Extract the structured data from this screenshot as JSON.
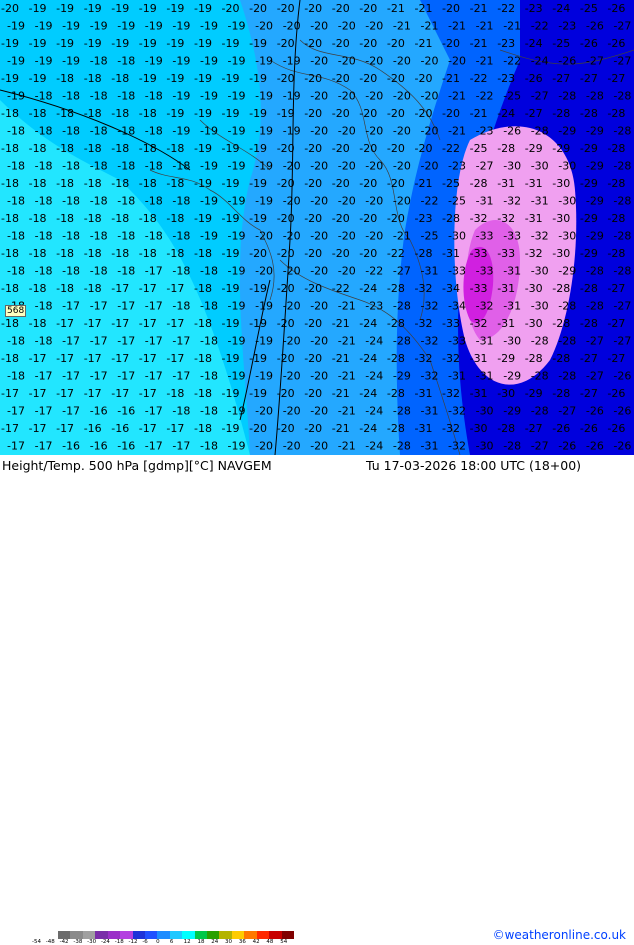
{
  "map": {
    "parameter_label": "Height/Temp. 500 hPa [gdmp][°C] NAVGEM",
    "valid_time": "Tu 17-03-2026 18:00 UTC (18+00)",
    "credit": "©weatheronline.co.uk",
    "station_marker": "568",
    "colors": {
      "temp_m19": "#00ccff",
      "temp_m18": "#22e6ff",
      "temp_m20": "#24a8ff",
      "temp_m24": "#0064ff",
      "temp_m28": "#0000dd",
      "temp_m30": "#f0a0f0",
      "temp_m33": "#e060e8",
      "temp_m34": "#d020e0"
    },
    "temperature_labels": [
      {
        "row": 0,
        "values": [
          "-20",
          "-19",
          "-19",
          "-19",
          "-19",
          "-19",
          "-19",
          "-19",
          "-20",
          "-20",
          "-20",
          "-20",
          "-20",
          "-20",
          "-21",
          "-21",
          "-20",
          "-21",
          "-22",
          "-23",
          "-24",
          "-25",
          "-26"
        ]
      },
      {
        "row": 1,
        "values": [
          "-19",
          "-19",
          "-19",
          "-19",
          "-19",
          "-19",
          "-19",
          "-19",
          "-19",
          "-20",
          "-20",
          "-20",
          "-20",
          "-20",
          "-21",
          "-21",
          "-21",
          "-21",
          "-21",
          "-22",
          "-23",
          "-26",
          "-27"
        ]
      },
      {
        "row": 2,
        "values": [
          "-19",
          "-19",
          "-19",
          "-19",
          "-19",
          "-19",
          "-19",
          "-19",
          "-19",
          "-19",
          "-20",
          "-20",
          "-20",
          "-20",
          "-20",
          "-21",
          "-20",
          "-21",
          "-23",
          "-24",
          "-25",
          "-26",
          "-26"
        ]
      },
      {
        "row": 3,
        "values": [
          "-19",
          "-19",
          "-19",
          "-18",
          "-18",
          "-19",
          "-19",
          "-19",
          "-19",
          "-19",
          "-19",
          "-20",
          "-20",
          "-20",
          "-20",
          "-20",
          "-20",
          "-21",
          "-22",
          "-24",
          "-26",
          "-27",
          "-27"
        ]
      },
      {
        "row": 4,
        "values": [
          "-19",
          "-19",
          "-18",
          "-18",
          "-18",
          "-19",
          "-19",
          "-19",
          "-19",
          "-19",
          "-20",
          "-20",
          "-20",
          "-20",
          "-20",
          "-20",
          "-21",
          "-22",
          "-23",
          "-26",
          "-27",
          "-27",
          "-27"
        ]
      },
      {
        "row": 5,
        "values": [
          "-19",
          "-18",
          "-18",
          "-18",
          "-18",
          "-18",
          "-19",
          "-19",
          "-19",
          "-19",
          "-19",
          "-20",
          "-20",
          "-20",
          "-20",
          "-20",
          "-21",
          "-22",
          "-25",
          "-27",
          "-28",
          "-28",
          "-28"
        ]
      },
      {
        "row": 6,
        "values": [
          "-18",
          "-18",
          "-18",
          "-18",
          "-18",
          "-18",
          "-19",
          "-19",
          "-19",
          "-19",
          "-19",
          "-20",
          "-20",
          "-20",
          "-20",
          "-20",
          "-20",
          "-21",
          "-24",
          "-27",
          "-28",
          "-28",
          "-28"
        ]
      },
      {
        "row": 7,
        "values": [
          "-18",
          "-18",
          "-18",
          "-18",
          "-18",
          "-18",
          "-19",
          "-19",
          "-19",
          "-19",
          "-19",
          "-20",
          "-20",
          "-20",
          "-20",
          "-20",
          "-21",
          "-23",
          "-26",
          "-28",
          "-29",
          "-29",
          "-28"
        ]
      },
      {
        "row": 8,
        "values": [
          "-18",
          "-18",
          "-18",
          "-18",
          "-18",
          "-18",
          "-18",
          "-19",
          "-19",
          "-19",
          "-20",
          "-20",
          "-20",
          "-20",
          "-20",
          "-20",
          "-22",
          "-25",
          "-28",
          "-29",
          "-29",
          "-29",
          "-28"
        ]
      },
      {
        "row": 9,
        "values": [
          "-18",
          "-18",
          "-18",
          "-18",
          "-18",
          "-18",
          "-18",
          "-19",
          "-19",
          "-19",
          "-20",
          "-20",
          "-20",
          "-20",
          "-20",
          "-20",
          "-23",
          "-27",
          "-30",
          "-30",
          "-30",
          "-29",
          "-28"
        ]
      },
      {
        "row": 10,
        "values": [
          "-18",
          "-18",
          "-18",
          "-18",
          "-18",
          "-18",
          "-18",
          "-19",
          "-19",
          "-19",
          "-20",
          "-20",
          "-20",
          "-20",
          "-20",
          "-21",
          "-25",
          "-28",
          "-31",
          "-31",
          "-30",
          "-29",
          "-28"
        ]
      },
      {
        "row": 11,
        "values": [
          "-18",
          "-18",
          "-18",
          "-18",
          "-18",
          "-18",
          "-18",
          "-19",
          "-19",
          "-19",
          "-20",
          "-20",
          "-20",
          "-20",
          "-20",
          "-22",
          "-25",
          "-31",
          "-32",
          "-31",
          "-30",
          "-29",
          "-28"
        ]
      },
      {
        "row": 12,
        "values": [
          "-18",
          "-18",
          "-18",
          "-18",
          "-18",
          "-18",
          "-18",
          "-19",
          "-19",
          "-19",
          "-20",
          "-20",
          "-20",
          "-20",
          "-20",
          "-23",
          "-28",
          "-32",
          "-32",
          "-31",
          "-30",
          "-29",
          "-28"
        ]
      },
      {
        "row": 13,
        "values": [
          "-18",
          "-18",
          "-18",
          "-18",
          "-18",
          "-18",
          "-18",
          "-19",
          "-19",
          "-20",
          "-20",
          "-20",
          "-20",
          "-20",
          "-21",
          "-25",
          "-30",
          "-33",
          "-33",
          "-32",
          "-30",
          "-29",
          "-28"
        ]
      },
      {
        "row": 14,
        "values": [
          "-18",
          "-18",
          "-18",
          "-18",
          "-18",
          "-18",
          "-18",
          "-18",
          "-19",
          "-20",
          "-20",
          "-20",
          "-20",
          "-20",
          "-22",
          "-28",
          "-31",
          "-33",
          "-33",
          "-32",
          "-30",
          "-29",
          "-28"
        ]
      },
      {
        "row": 15,
        "values": [
          "-18",
          "-18",
          "-18",
          "-18",
          "-18",
          "-17",
          "-18",
          "-18",
          "-19",
          "-20",
          "-20",
          "-20",
          "-20",
          "-22",
          "-27",
          "-31",
          "-33",
          "-33",
          "-31",
          "-30",
          "-29",
          "-28",
          "-28"
        ]
      },
      {
        "row": 16,
        "values": [
          "-18",
          "-18",
          "-18",
          "-18",
          "-17",
          "-17",
          "-17",
          "-18",
          "-19",
          "-19",
          "-20",
          "-20",
          "-22",
          "-24",
          "-28",
          "-32",
          "-34",
          "-33",
          "-31",
          "-30",
          "-28",
          "-28",
          "-27"
        ]
      },
      {
        "row": 17,
        "values": [
          "-18",
          "-18",
          "-17",
          "-17",
          "-17",
          "-17",
          "-18",
          "-18",
          "-19",
          "-19",
          "-20",
          "-20",
          "-21",
          "-23",
          "-28",
          "-32",
          "-34",
          "-32",
          "-31",
          "-30",
          "-28",
          "-28",
          "-27"
        ]
      },
      {
        "row": 18,
        "values": [
          "-18",
          "-18",
          "-17",
          "-17",
          "-17",
          "-17",
          "-17",
          "-18",
          "-19",
          "-19",
          "-20",
          "-20",
          "-21",
          "-24",
          "-28",
          "-32",
          "-33",
          "-32",
          "-31",
          "-30",
          "-28",
          "-28",
          "-27"
        ]
      },
      {
        "row": 19,
        "values": [
          "-18",
          "-18",
          "-17",
          "-17",
          "-17",
          "-17",
          "-17",
          "-18",
          "-19",
          "-19",
          "-20",
          "-20",
          "-21",
          "-24",
          "-28",
          "-32",
          "-33",
          "-31",
          "-30",
          "-28",
          "-28",
          "-27",
          "-27"
        ]
      },
      {
        "row": 20,
        "values": [
          "-18",
          "-17",
          "-17",
          "-17",
          "-17",
          "-17",
          "-17",
          "-18",
          "-19",
          "-19",
          "-20",
          "-20",
          "-21",
          "-24",
          "-28",
          "-32",
          "-32",
          "-31",
          "-29",
          "-28",
          "-28",
          "-27",
          "-27"
        ]
      },
      {
        "row": 21,
        "values": [
          "-18",
          "-17",
          "-17",
          "-17",
          "-17",
          "-17",
          "-17",
          "-18",
          "-19",
          "-19",
          "-20",
          "-20",
          "-21",
          "-24",
          "-29",
          "-32",
          "-31",
          "-31",
          "-29",
          "-28",
          "-28",
          "-27",
          "-26"
        ]
      },
      {
        "row": 22,
        "values": [
          "-17",
          "-17",
          "-17",
          "-17",
          "-17",
          "-17",
          "-18",
          "-18",
          "-19",
          "-19",
          "-20",
          "-20",
          "-21",
          "-24",
          "-28",
          "-31",
          "-32",
          "-31",
          "-30",
          "-29",
          "-28",
          "-27",
          "-26"
        ]
      },
      {
        "row": 23,
        "values": [
          "-17",
          "-17",
          "-17",
          "-16",
          "-16",
          "-17",
          "-18",
          "-18",
          "-19",
          "-20",
          "-20",
          "-20",
          "-21",
          "-24",
          "-28",
          "-31",
          "-32",
          "-30",
          "-29",
          "-28",
          "-27",
          "-26",
          "-26"
        ]
      },
      {
        "row": 24,
        "values": [
          "-17",
          "-17",
          "-17",
          "-16",
          "-16",
          "-17",
          "-17",
          "-18",
          "-19",
          "-20",
          "-20",
          "-20",
          "-21",
          "-24",
          "-28",
          "-31",
          "-32",
          "-30",
          "-28",
          "-27",
          "-26",
          "-26",
          "-26"
        ]
      },
      {
        "row": 25,
        "values": [
          "-17",
          "-17",
          "-16",
          "-16",
          "-16",
          "-17",
          "-17",
          "-18",
          "-19",
          "-20",
          "-20",
          "-20",
          "-21",
          "-24",
          "-28",
          "-31",
          "-32",
          "-30",
          "-28",
          "-27",
          "-26",
          "-26",
          "-26"
        ]
      }
    ],
    "colorbar": {
      "ticks": [
        "-54",
        "-48",
        "-42",
        "-38",
        "-30",
        "-24",
        "-18",
        "-12",
        "-6",
        "0",
        "6",
        "12",
        "18",
        "24",
        "30",
        "36",
        "42",
        "48",
        "54"
      ],
      "colors": [
        "#6b6b6b",
        "#8a8a8a",
        "#a0a0a0",
        "#7a2ea8",
        "#9b30c8",
        "#b440e0",
        "#1e32d8",
        "#2050ff",
        "#1e8cff",
        "#1ec8ff",
        "#00ffff",
        "#00c848",
        "#2aa000",
        "#b4b400",
        "#ffcc00",
        "#ff7800",
        "#ff2800",
        "#c80000",
        "#800000"
      ]
    }
  }
}
